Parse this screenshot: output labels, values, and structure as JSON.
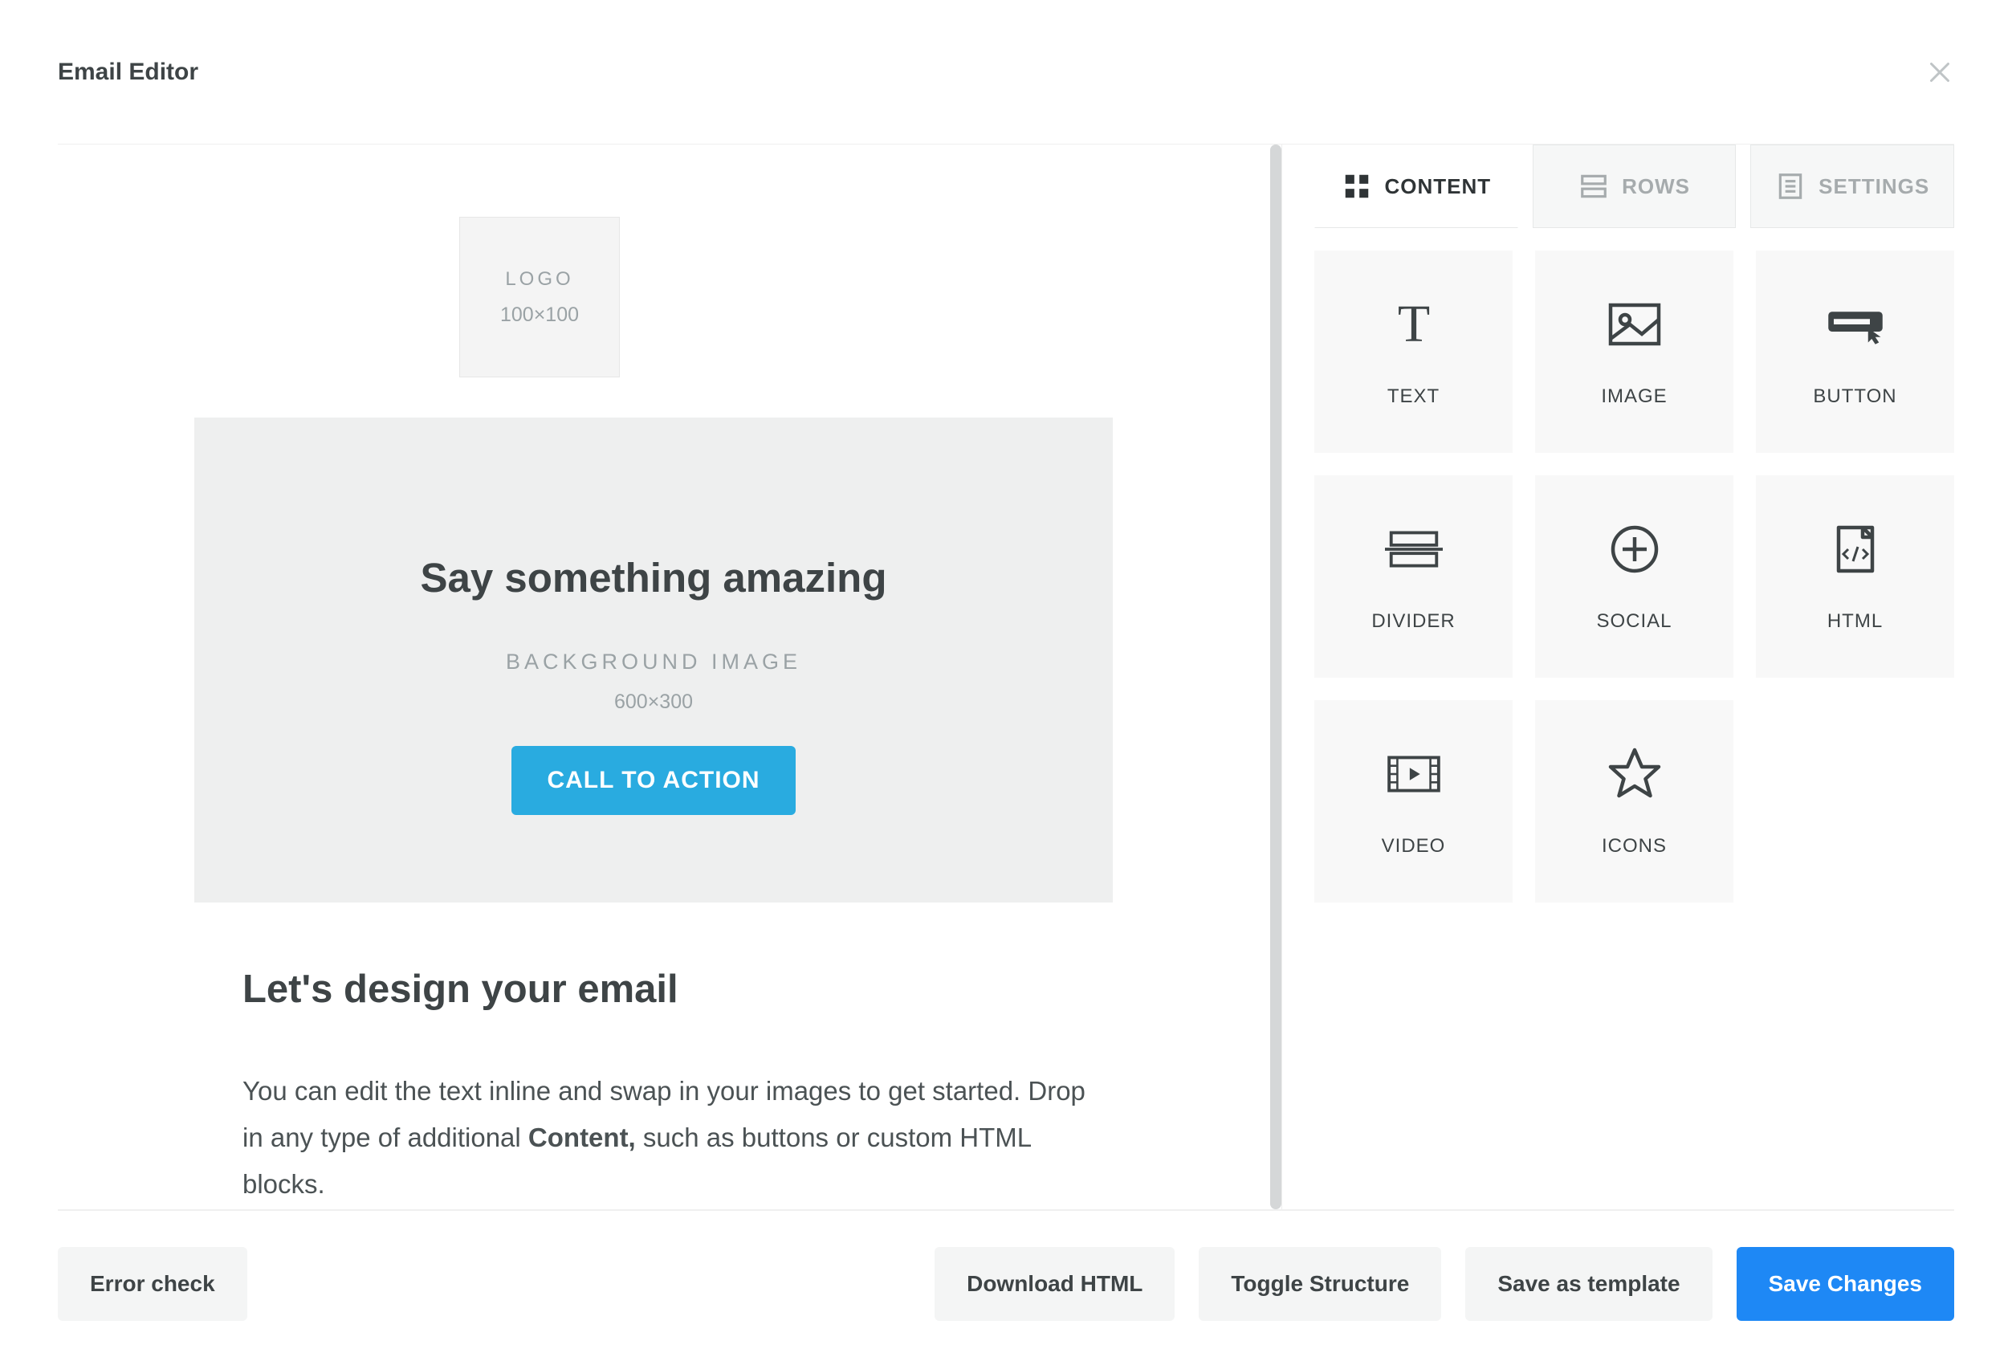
{
  "header": {
    "title": "Email Editor"
  },
  "canvas": {
    "logo": {
      "label": "LOGO",
      "dims": "100×100"
    },
    "hero": {
      "headline": "Say something amazing",
      "bg_label": "BACKGROUND IMAGE",
      "dims": "600×300",
      "cta_label": "CALL TO ACTION"
    },
    "section": {
      "heading": "Let's design your email",
      "body_pre": "You can edit the text inline and swap in your images to get started. Drop in any type of additional ",
      "body_bold": "Content,",
      "body_post": " such as buttons or custom HTML blocks."
    }
  },
  "sidebar": {
    "tabs": [
      {
        "label": "CONTENT",
        "active": true
      },
      {
        "label": "ROWS",
        "active": false
      },
      {
        "label": "SETTINGS",
        "active": false
      }
    ],
    "blocks": [
      {
        "id": "text",
        "label": "TEXT"
      },
      {
        "id": "image",
        "label": "IMAGE"
      },
      {
        "id": "button",
        "label": "BUTTON"
      },
      {
        "id": "divider",
        "label": "DIVIDER"
      },
      {
        "id": "social",
        "label": "SOCIAL"
      },
      {
        "id": "html",
        "label": "HTML"
      },
      {
        "id": "video",
        "label": "VIDEO"
      },
      {
        "id": "icons",
        "label": "ICONS"
      }
    ]
  },
  "footer": {
    "error_check": "Error check",
    "download": "Download HTML",
    "toggle": "Toggle Structure",
    "save_template": "Save as template",
    "save_changes": "Save Changes"
  }
}
